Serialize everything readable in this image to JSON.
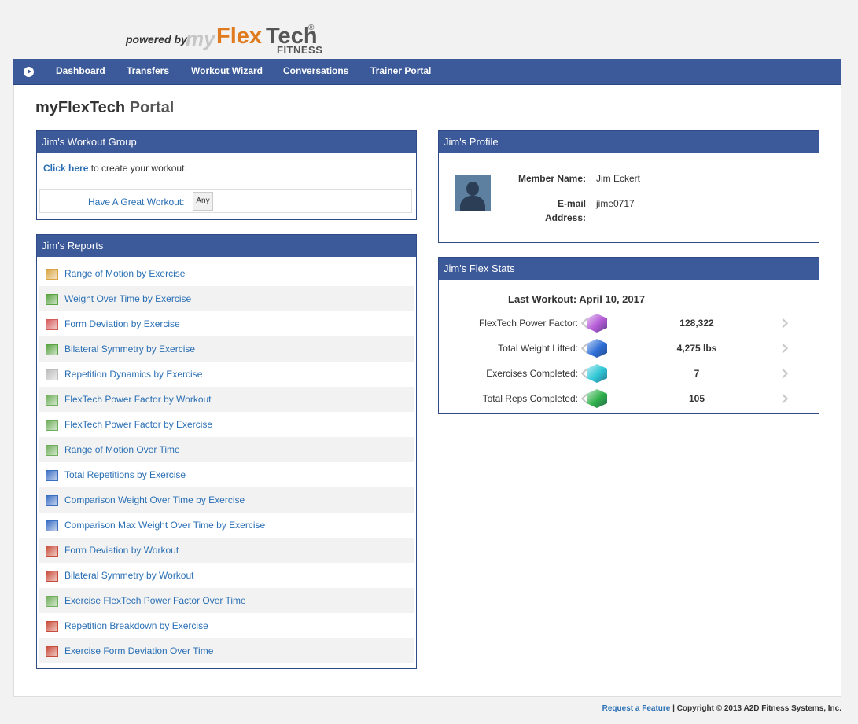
{
  "logo": {
    "powered": "powered by",
    "my": "my",
    "flex": "Flex",
    "tech": "Tech",
    "reg": "®",
    "fitness": "FITNESS"
  },
  "nav": {
    "items": [
      "Dashboard",
      "Transfers",
      "Workout Wizard",
      "Conversations",
      "Trainer Portal"
    ]
  },
  "page": {
    "title_main": "myFlexTech",
    "title_rest": "Portal"
  },
  "workout_group": {
    "title": "Jim's Workout Group",
    "link": "Click here",
    "text": "to create your workout.",
    "label": "Have A Great Workout:",
    "select": "Any"
  },
  "reports": {
    "title": "Jim's Reports",
    "items": [
      {
        "label": "Range of Motion by Exercise",
        "icon": "rom-chart-icon",
        "color": "#d9a441"
      },
      {
        "label": "Weight Over Time by Exercise",
        "icon": "hierarchy-icon",
        "color": "#5aa342"
      },
      {
        "label": "Form Deviation by Exercise",
        "icon": "form-chart-icon",
        "color": "#d65b5b"
      },
      {
        "label": "Bilateral Symmetry by Exercise",
        "icon": "hierarchy-icon",
        "color": "#5aa342"
      },
      {
        "label": "Repetition Dynamics by Exercise",
        "icon": "hierarchy-gray-icon",
        "color": "#bdbdbd"
      },
      {
        "label": "FlexTech Power Factor by Workout",
        "icon": "line-chart-icon",
        "color": "#6fae5a"
      },
      {
        "label": "FlexTech Power Factor by Exercise",
        "icon": "line-chart-icon",
        "color": "#6fae5a"
      },
      {
        "label": "Range of Motion Over Time",
        "icon": "line-chart-icon",
        "color": "#6fae5a"
      },
      {
        "label": "Total Repetitions by Exercise",
        "icon": "bar-chart-icon",
        "color": "#3b6fc4"
      },
      {
        "label": "Comparison Weight Over Time by Exercise",
        "icon": "bar-chart-icon",
        "color": "#3b6fc4"
      },
      {
        "label": "Comparison Max Weight Over Time by Exercise",
        "icon": "bar-chart-icon",
        "color": "#3b6fc4"
      },
      {
        "label": "Form Deviation by Workout",
        "icon": "grid-chart-icon",
        "color": "#c94c3a"
      },
      {
        "label": "Bilateral Symmetry by Workout",
        "icon": "grid-chart-icon",
        "color": "#c94c3a"
      },
      {
        "label": "Exercise FlexTech Power Factor Over Time",
        "icon": "line-chart-icon",
        "color": "#6fae5a"
      },
      {
        "label": "Repetition Breakdown by Exercise",
        "icon": "grid-chart-icon",
        "color": "#c94c3a"
      },
      {
        "label": "Exercise Form Deviation Over Time",
        "icon": "grid-chart-icon",
        "color": "#c94c3a"
      }
    ]
  },
  "profile": {
    "title": "Jim's Profile",
    "member_label": "Member Name:",
    "member_value": "Jim Eckert",
    "email_label_1": "E-mail",
    "email_label_2": "Address:",
    "email_value": "jime0717"
  },
  "flex_stats": {
    "title": "Jim's Flex Stats",
    "last_workout": "Last Workout: April 10, 2017",
    "rows": [
      {
        "label": "FlexTech Power Factor:",
        "value": "128,322",
        "color": "#b45ad6"
      },
      {
        "label": "Total Weight Lifted:",
        "value": "4,275 lbs",
        "color": "#2f6fd6"
      },
      {
        "label": "Exercises Completed:",
        "value": "7",
        "color": "#2fc7d6"
      },
      {
        "label": "Total Reps Completed:",
        "value": "105",
        "color": "#2fb04a"
      }
    ]
  },
  "footer": {
    "link": "Request a Feature",
    "text": " | Copyright © 2013 A2D Fitness Systems, Inc."
  }
}
